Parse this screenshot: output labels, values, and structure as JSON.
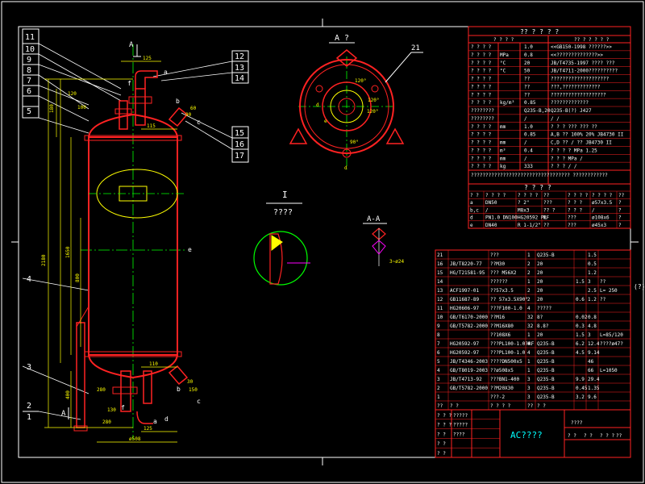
{
  "colors": {
    "background": "#000000",
    "frame": "#ffffff",
    "vessel": "#ff2222",
    "dim": "#ffff00",
    "centerline": "#00ff00",
    "table": "#ff2222",
    "text": "#ffffff",
    "cyan": "#00ffff",
    "magenta": "#ff00ff"
  },
  "leaders_left": [
    "11",
    "10",
    "9",
    "8",
    "7",
    "6",
    "5",
    "4",
    "3",
    "2",
    "1"
  ],
  "leaders_right": [
    "12",
    "13",
    "14",
    "15",
    "16",
    "17"
  ],
  "view_labels": {
    "top_a": "A",
    "top_arrow": "A",
    "bottom_a": "A",
    "bottom_arrow": "A",
    "view_a": "A ?",
    "detail_i": "I",
    "detail_scale": "????",
    "section": "A-A",
    "leader_21": "21"
  },
  "side_dims": {
    "d180": "180",
    "d1650": "1650",
    "d2180": "2180",
    "d800": "800",
    "d400": "400",
    "d125": "125",
    "d115": "115",
    "d110": "110",
    "d120": "120",
    "d100": "100",
    "d130": "130",
    "d280": "280",
    "d280b": "280",
    "d125b": "125",
    "d90": "90",
    "d60": "60",
    "d30": "30",
    "d150": "150",
    "d508": "ø508"
  },
  "nozzle_letters": {
    "a": "a",
    "b": "b",
    "c": "c",
    "d": "d",
    "f": "f",
    "f2": "f",
    "e": "e",
    "d2": "d",
    "c2": "c",
    "a2": "a",
    "b2": "b"
  },
  "plan_labels": {
    "a": "a",
    "b": "b",
    "c": "c",
    "d": "d",
    "e": "e",
    "ang1": "120°",
    "ang2": "120°",
    "ang3": "90°",
    "ang4": "120°"
  },
  "section_dims": {
    "s1": "3~ø24"
  },
  "right_marker": "(?)",
  "tech": {
    "header": "?? ? ? ? ?",
    "sub_left": "? ? ? ?",
    "sub_right": "?? ? ? ? ? ?",
    "rows": [
      {
        "a": "? ? ? ?",
        "u": "",
        "v": "1.0",
        "r": "<<GB150-1998 ??????>>"
      },
      {
        "a": "? ? ? ?",
        "u": "MPa",
        "v": "0.8",
        "r": "<<??????????????>>"
      },
      {
        "a": "? ? ? ?",
        "u": "°C",
        "v": "20",
        "r": "JB/T4735-1997 ???? ???"
      },
      {
        "a": "? ? ? ?",
        "u": "°C",
        "v": "50",
        "r": "JB/T4711-2000??????????"
      },
      {
        "a": "? ? ? ?",
        "u": "",
        "v": "??",
        "r": "????????????????????"
      },
      {
        "a": "? ? ? ?",
        "u": "",
        "v": "??",
        "r": "???,?????????????"
      },
      {
        "a": "? ? ? ?",
        "u": "",
        "v": "??",
        "r": "???????????????????"
      },
      {
        "a": "? ? ? ?",
        "u": "kg/m³",
        "v": "0.85",
        "r": "?????????????"
      },
      {
        "a": "????????",
        "u": "",
        "v": "Q235-B,20",
        "r": "Q235-B(?)      J427"
      },
      {
        "a": "????????",
        "u": "",
        "v": "/",
        "r": "/            /"
      },
      {
        "a": "? ? ? ?",
        "u": "mm",
        "v": "1.0",
        "r": "? ? ?  ??? ??? ??"
      },
      {
        "a": "? ? ? ?",
        "u": "",
        "v": "0.85",
        "r": "A,B ?? 100% 20% JB4730 II"
      },
      {
        "a": "? ? ? ?",
        "u": "mm",
        "v": "/",
        "r": "C,D ?? /  ??  JB4730 II"
      },
      {
        "a": "? ? ? ?",
        "u": "m³",
        "v": "0.4",
        "r": "? ? ? ?   MPa   1.25"
      },
      {
        "a": "? ? ? ?",
        "u": "mm",
        "v": "/",
        "r": "? ? ?   MPa   /"
      },
      {
        "a": "? ? ? ?",
        "u": "kg",
        "v": "333",
        "r": "? ? ?   /   /"
      }
    ],
    "note": "??????????????????????????????????  ????????????"
  },
  "nozzles": {
    "title": "? ? ? ?",
    "headers": [
      "? ?",
      "? ? ? ?",
      "? ? ? ?",
      "??",
      "? ? ? ?",
      "? ? ? ?",
      "??"
    ],
    "rows": [
      [
        "a",
        "DN50",
        "? 2\"",
        "???",
        "? ? ?",
        "ø57x3.5",
        "?"
      ],
      [
        "b,c",
        "/",
        "M8x3",
        "?? ?",
        "? ? ?",
        "/",
        "?"
      ],
      [
        "d",
        "PN1.0 DN100",
        "HG20592 PL",
        "RF",
        "???",
        "ø108x6",
        "?"
      ],
      [
        "e",
        "DN40",
        "R 1-1/2\"",
        "??",
        "???",
        "ø45x3",
        "?"
      ]
    ]
  },
  "bom": {
    "rows": [
      [
        "21",
        "",
        "???",
        "1",
        "Q235-B",
        "",
        "1.5",
        ""
      ],
      [
        "16",
        "JB/T8220-77",
        "??M30",
        "2",
        "20",
        "",
        "0.5",
        ""
      ],
      [
        "15",
        "HG/T21581-95",
        "??? M56X2",
        "2",
        "20",
        "",
        "1.2",
        ""
      ],
      [
        "14",
        "",
        "??????",
        "1",
        "20",
        "1.5",
        "3",
        "??"
      ],
      [
        "13",
        "ACF1997-01",
        "??57x3.5",
        "2",
        "20",
        "",
        "2.5",
        "L= 250"
      ],
      [
        "12",
        "GB11687-89",
        "?? 57x3.5X90°",
        "2",
        "20",
        "0.6",
        "1.2",
        "??"
      ],
      [
        "11",
        "HG20606-97",
        "???F100-1.0",
        "4",
        "?????",
        "",
        "",
        ""
      ],
      [
        "10",
        "GB/T6170-2000",
        "??M16",
        "32",
        "8?",
        "0.02",
        "0.8",
        ""
      ],
      [
        "9",
        "GB/T5782-2000",
        "??M16X80",
        "32",
        "8.8?",
        "0.3",
        "4.8",
        ""
      ],
      [
        "8",
        "",
        "??108X6",
        "1",
        "20",
        "1.5",
        "3",
        "L=85/120"
      ],
      [
        "7",
        "HG20592-97",
        "???PL100-1.0?RF",
        "4",
        "Q235-B",
        "6.2",
        "12.4",
        "????ø47?"
      ],
      [
        "6",
        "HG20592-97",
        "???PL100-1.0",
        "4",
        "Q235-B",
        "4.5",
        "9.14",
        ""
      ],
      [
        "5",
        "JB/T4346-2003",
        "????DN500x5",
        "1",
        "Q235-B",
        "",
        "46",
        ""
      ],
      [
        "4",
        "GB/T8019-2003",
        "??ø508x5",
        "1",
        "Q235-B",
        "",
        "66",
        "L=1050"
      ],
      [
        "3",
        "JB/T4713-92",
        "???BN1-400",
        "3",
        "Q235-B",
        "9.9",
        "29.4",
        ""
      ],
      [
        "2",
        "GB/T5782-2000",
        "??M20X30",
        "3",
        "Q235-B",
        "0.45",
        "1.35",
        ""
      ],
      [
        "1",
        "",
        "???-2",
        "3",
        "Q235-B",
        "3.2",
        "9.6",
        ""
      ],
      [
        "??",
        "? ?",
        "? ? ? ?",
        "??",
        "? ?",
        "",
        "",
        ""
      ]
    ]
  },
  "title_block": {
    "name": "AC????",
    "left_rows": [
      "? ? ?",
      "? ? ?",
      "? ?",
      "? ?",
      "? ?"
    ],
    "left_cells": [
      "?????",
      "?????",
      "????"
    ],
    "right_top": "????",
    "right_cells": [
      "? ?",
      "? ?",
      "? ? ?",
      "??"
    ]
  }
}
